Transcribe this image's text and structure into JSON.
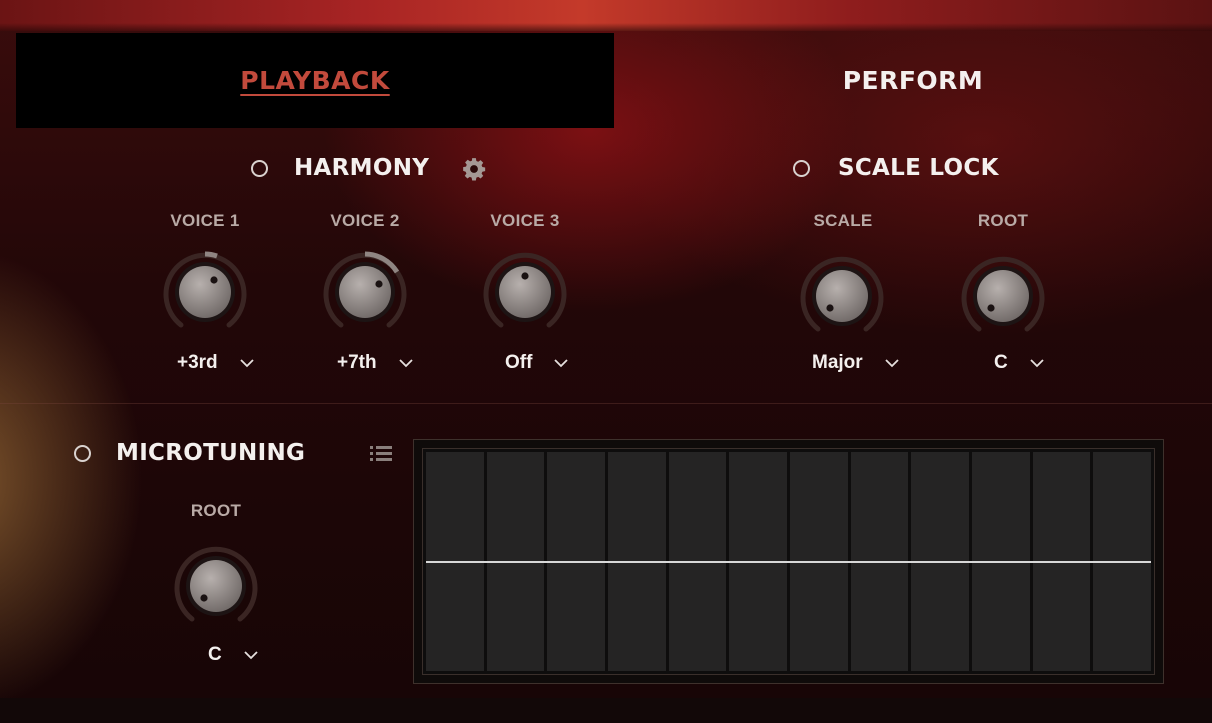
{
  "tabs": [
    {
      "label": "PLAYBACK",
      "active": true
    },
    {
      "label": "PERFORM",
      "active": false
    }
  ],
  "harmony": {
    "title": "HARMONY",
    "enabled": false,
    "voices": [
      {
        "label": "VOICE 1",
        "value": "+3rd"
      },
      {
        "label": "VOICE 2",
        "value": "+7th"
      },
      {
        "label": "VOICE 3",
        "value": "Off"
      }
    ]
  },
  "scale_lock": {
    "title": "SCALE LOCK",
    "enabled": false,
    "scale": {
      "label": "SCALE",
      "value": "Major"
    },
    "root": {
      "label": "ROOT",
      "value": "C"
    }
  },
  "microtuning": {
    "title": "MICROTUNING",
    "enabled": false,
    "root": {
      "label": "ROOT",
      "value": "C"
    },
    "key_count": 12
  },
  "icons": {
    "harmony_settings": "gear-icon",
    "microtuning_presets": "list-icon",
    "dropdown": "chevron-down-icon"
  },
  "colors": {
    "active_tab_text": "#c24a3c",
    "accent_red": "#a82424",
    "text": "#f4f0ee",
    "label": "#b9aaa6"
  }
}
